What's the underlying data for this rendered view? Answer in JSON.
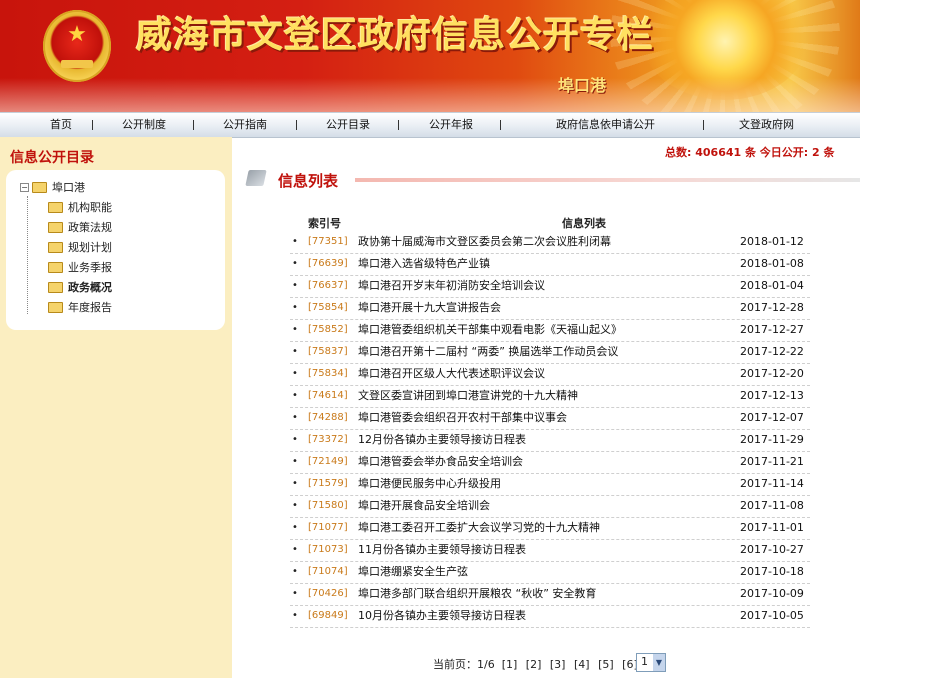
{
  "banner": {
    "title": "威海市文登区政府信息公开专栏",
    "subtitle": "埠口港"
  },
  "nav": [
    "首页",
    "公开制度",
    "公开指南",
    "公开目录",
    "公开年报",
    "政府信息依申请公开",
    "文登政府网"
  ],
  "sidebar": {
    "title": "信息公开目录",
    "root": "埠口港",
    "items": [
      "机构职能",
      "政策法规",
      "规划计划",
      "业务季报",
      "政务概况",
      "年度报告"
    ]
  },
  "stats": {
    "text": "总数: 406641 条   今日公开: 2 条"
  },
  "list": {
    "heading": "信息列表",
    "col_index": "索引号",
    "col_list": "信息列表",
    "rows": [
      {
        "bullet": "•",
        "index": "[77351]",
        "title": "政协第十届威海市文登区委员会第二次会议胜利闭幕",
        "date": "2018-01-12"
      },
      {
        "bullet": "•",
        "index": "[76639]",
        "title": "埠口港入选省级特色产业镇",
        "date": "2018-01-08"
      },
      {
        "bullet": "•",
        "index": "[76637]",
        "title": "埠口港召开岁末年初消防安全培训会议",
        "date": "2018-01-04"
      },
      {
        "bullet": "•",
        "index": "[75854]",
        "title": "埠口港开展十九大宣讲报告会",
        "date": "2017-12-28"
      },
      {
        "bullet": "•",
        "index": "[75852]",
        "title": "埠口港管委组织机关干部集中观看电影《天福山起义》",
        "date": "2017-12-27"
      },
      {
        "bullet": "•",
        "index": "[75837]",
        "title": "埠口港召开第十二届村 “两委” 换届选举工作动员会议",
        "date": "2017-12-22"
      },
      {
        "bullet": "•",
        "index": "[75834]",
        "title": "埠口港召开区级人大代表述职评议会议",
        "date": "2017-12-20"
      },
      {
        "bullet": "•",
        "index": "[74614]",
        "title": "文登区委宣讲团到埠口港宣讲党的十九大精神",
        "date": "2017-12-13"
      },
      {
        "bullet": "•",
        "index": "[74288]",
        "title": "埠口港管委会组织召开农村干部集中议事会",
        "date": "2017-12-07"
      },
      {
        "bullet": "•",
        "index": "[73372]",
        "title": "12月份各镇办主要领导接访日程表",
        "date": "2017-11-29"
      },
      {
        "bullet": "•",
        "index": "[72149]",
        "title": "埠口港管委会举办食品安全培训会",
        "date": "2017-11-21"
      },
      {
        "bullet": "•",
        "index": "[71579]",
        "title": "埠口港便民服务中心升级投用",
        "date": "2017-11-14"
      },
      {
        "bullet": "•",
        "index": "[71580]",
        "title": "埠口港开展食品安全培训会",
        "date": "2017-11-08"
      },
      {
        "bullet": "•",
        "index": "[71077]",
        "title": "埠口港工委召开工委扩大会议学习党的十九大精神",
        "date": "2017-11-01"
      },
      {
        "bullet": "•",
        "index": "[71073]",
        "title": "11月份各镇办主要领导接访日程表",
        "date": "2017-10-27"
      },
      {
        "bullet": "•",
        "index": "[71074]",
        "title": "埠口港绷紧安全生产弦",
        "date": "2017-10-18"
      },
      {
        "bullet": "•",
        "index": "[70426]",
        "title": "埠口港多部门联合组织开展粮农 “秋收” 安全教育",
        "date": "2017-10-09"
      },
      {
        "bullet": "•",
        "index": "[69849]",
        "title": "10月份各镇办主要领导接访日程表",
        "date": "2017-10-05"
      }
    ]
  },
  "pager": {
    "current_label": "当前页：1/6",
    "pages": [
      "[1]",
      "[2]",
      "[3]",
      "[4]",
      "[5]",
      "[6]"
    ],
    "select_value": "1"
  }
}
